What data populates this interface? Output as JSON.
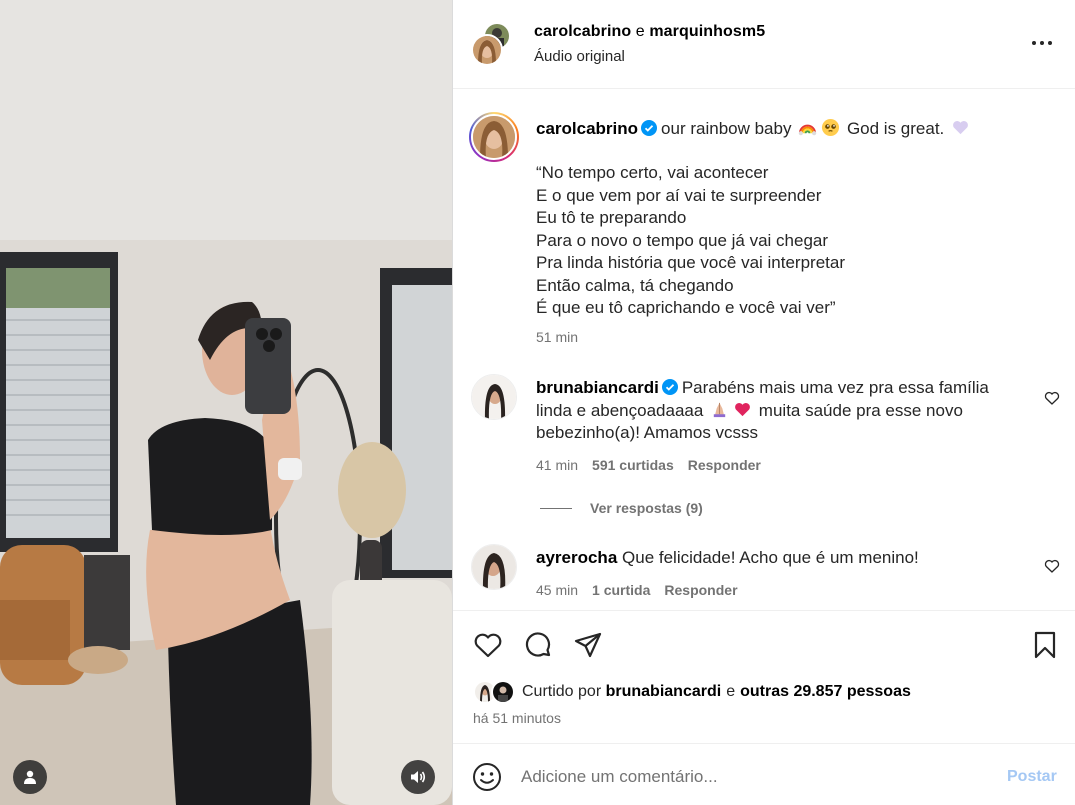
{
  "header": {
    "user1": "carolcabrino",
    "separator": "e",
    "user2": "marquinhosm5",
    "audio": "Áudio original",
    "more_icon": "more-horizontal-icon"
  },
  "caption": {
    "username": "carolcabrino",
    "text_before": "our rainbow baby",
    "text_after": "God is great.",
    "emojis": [
      "rainbow-emoji",
      "pleading-face-emoji",
      "heart-emoji"
    ],
    "poem": [
      "“No tempo certo, vai acontecer",
      "E o que vem por aí vai te surpreender",
      "Eu tô te preparando",
      "Para o novo o tempo que já vai chegar",
      "Pra linda história que você vai interpretar",
      "Então calma, tá chegando",
      "É que eu tô caprichando e você vai ver”"
    ],
    "time": "51 min"
  },
  "comments": [
    {
      "username": "brunabiancardi",
      "verified": true,
      "line1": "Parabéns mais uma vez pra essa família",
      "line2a": "linda e abençoadaaaa",
      "line2b": "muita saúde pra esse novo",
      "line3": "bebezinho(a)! Amamos vcsss",
      "time": "41 min",
      "likes": "591 curtidas",
      "reply": "Responder",
      "view_replies": "Ver respostas (9)"
    },
    {
      "username": "ayrerocha",
      "verified": false,
      "text": "Que felicidade! Acho que é um menino!",
      "time": "45 min",
      "likes": "1 curtida",
      "reply": "Responder"
    }
  ],
  "likes": {
    "prefix": "Curtido por",
    "user": "brunabiancardi",
    "mid": "e",
    "others": "outras 29.857 pessoas",
    "time_ago": "há 51 minutos"
  },
  "add_comment": {
    "placeholder": "Adicione um comentário...",
    "post": "Postar"
  },
  "colors": {
    "verified": "#0095f6",
    "muted": "#737373",
    "post_disabled": "#a5c8f4",
    "heart": "#e0245e"
  }
}
